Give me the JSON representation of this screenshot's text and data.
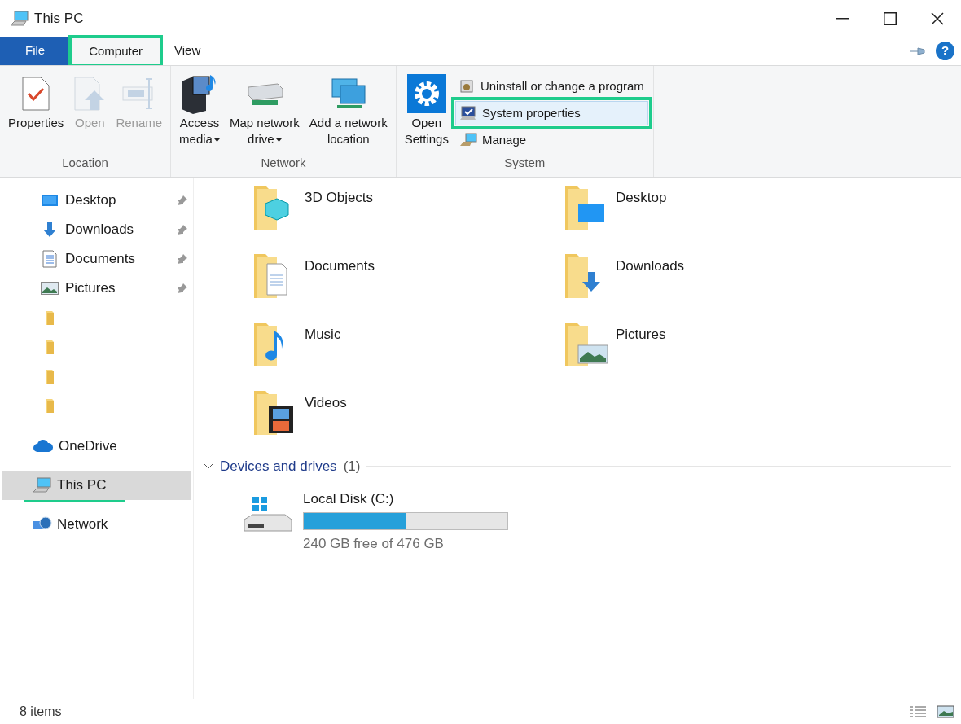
{
  "window": {
    "title": "This PC"
  },
  "ribbon_tabs": [
    {
      "label": "File",
      "kind": "file",
      "selected": false,
      "highlighted": false
    },
    {
      "label": "Computer",
      "kind": "tab",
      "selected": true,
      "highlighted": true
    },
    {
      "label": "View",
      "kind": "tab",
      "selected": false,
      "highlighted": false
    }
  ],
  "ribbon_groups": [
    {
      "label": "Location",
      "buttons": [
        {
          "kind": "properties",
          "lines": [
            "Properties"
          ],
          "disabled": false,
          "dropdown": false
        },
        {
          "kind": "open",
          "lines": [
            "Open"
          ],
          "disabled": true,
          "dropdown": false
        },
        {
          "kind": "rename",
          "lines": [
            "Rename"
          ],
          "disabled": true,
          "dropdown": false
        }
      ]
    },
    {
      "label": "Network",
      "buttons": [
        {
          "kind": "media",
          "lines": [
            "Access",
            "media"
          ],
          "disabled": false,
          "dropdown": true
        },
        {
          "kind": "drive",
          "lines": [
            "Map network",
            "drive"
          ],
          "disabled": false,
          "dropdown": true
        },
        {
          "kind": "location",
          "lines": [
            "Add a network",
            "location"
          ],
          "disabled": false,
          "dropdown": false
        }
      ]
    },
    {
      "label": "System",
      "buttons": [
        {
          "kind": "settings",
          "lines": [
            "Open",
            "Settings"
          ],
          "disabled": false,
          "dropdown": false
        }
      ],
      "small_buttons": [
        {
          "kind": "uninstall",
          "label": "Uninstall or change a program",
          "highlighted": false
        },
        {
          "kind": "sysprops",
          "label": "System properties",
          "highlighted": true
        },
        {
          "kind": "manage",
          "label": "Manage",
          "highlighted": false
        }
      ]
    }
  ],
  "quick_access": [
    {
      "kind": "desktop",
      "label": "Desktop",
      "pinned": true
    },
    {
      "kind": "downloads",
      "label": "Downloads",
      "pinned": true
    },
    {
      "kind": "documents",
      "label": "Documents",
      "pinned": true
    },
    {
      "kind": "pictures",
      "label": "Pictures",
      "pinned": true
    },
    {
      "kind": "folder",
      "pinned": false
    },
    {
      "kind": "folder",
      "pinned": false
    },
    {
      "kind": "folder",
      "pinned": false
    },
    {
      "kind": "folder",
      "pinned": false
    }
  ],
  "sidebar": [
    {
      "kind": "onedrive",
      "label": "OneDrive",
      "selected": false,
      "highlighted": false
    },
    {
      "kind": "pc",
      "label": "This PC",
      "selected": true,
      "highlighted": true
    },
    {
      "kind": "network",
      "label": "Network",
      "selected": false,
      "highlighted": false
    }
  ],
  "folders": [
    {
      "kind": "cube",
      "label": "3D Objects"
    },
    {
      "kind": "desktop",
      "label": "Desktop"
    },
    {
      "kind": "documents",
      "label": "Documents"
    },
    {
      "kind": "downloads",
      "label": "Downloads"
    },
    {
      "kind": "music",
      "label": "Music"
    },
    {
      "kind": "pictures",
      "label": "Pictures"
    },
    {
      "kind": "videos",
      "label": "Videos"
    }
  ],
  "devices": {
    "label": "Devices and drives",
    "count": "(1)",
    "expanded": true,
    "drives": [
      {
        "name": "Local Disk (C:)",
        "level": 0.5,
        "free": "240 GB free of 476 GB"
      }
    ]
  },
  "help_button": {
    "label": "?"
  },
  "status_bar": {
    "items": "8 items"
  }
}
